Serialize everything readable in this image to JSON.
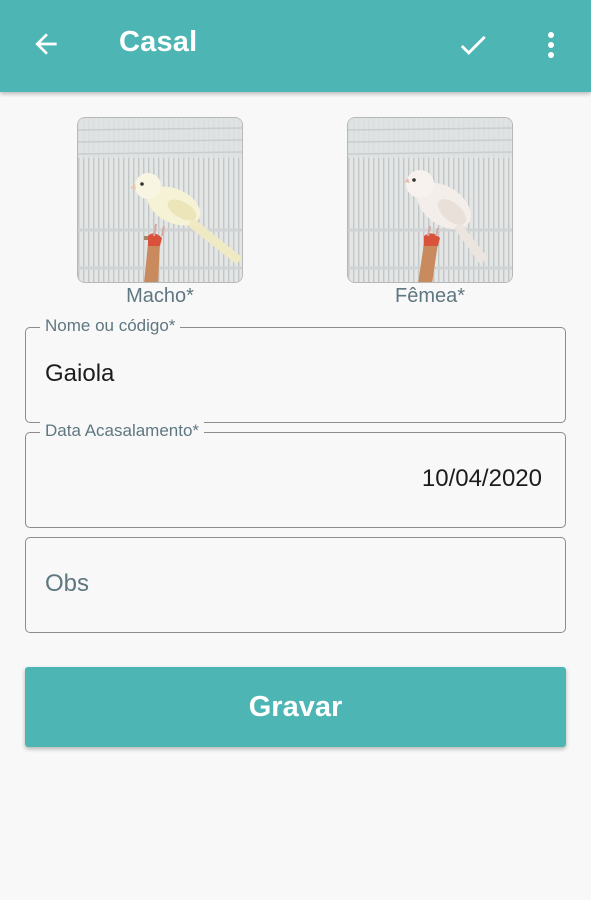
{
  "appbar": {
    "title": "Casal",
    "back_icon": "arrow-back-icon",
    "confirm_icon": "check-icon",
    "menu_icon": "more-vert-icon",
    "color": "#4db6b5"
  },
  "photos": {
    "male_label": "Macho*",
    "female_label": "Fêmea*"
  },
  "form": {
    "name": {
      "label": "Nome ou código*",
      "value": "Gaiola"
    },
    "date": {
      "label": "Data Acasalamento*",
      "value": "10/04/2020"
    },
    "obs": {
      "placeholder": "Obs"
    }
  },
  "save_button": {
    "label": "Gravar",
    "color": "#4db6b5"
  }
}
